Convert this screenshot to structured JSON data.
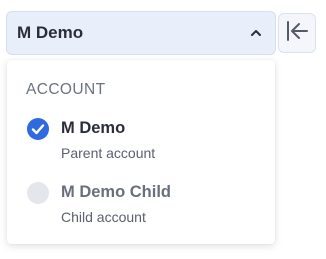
{
  "account_selector": {
    "label": "M Demo",
    "chevron_icon": "chevron-up-icon"
  },
  "collapse_button": {
    "icon": "collapse-left-icon"
  },
  "dropdown": {
    "heading": "ACCOUNT",
    "options": [
      {
        "name": "M Demo",
        "description": "Parent account",
        "selected": true
      },
      {
        "name": "M Demo Child",
        "description": "Child account",
        "selected": false
      }
    ]
  },
  "colors": {
    "accent": "#2f6ae0",
    "selector_bg": "#e9eefb",
    "unselected_radio": "#e4e6eb"
  }
}
